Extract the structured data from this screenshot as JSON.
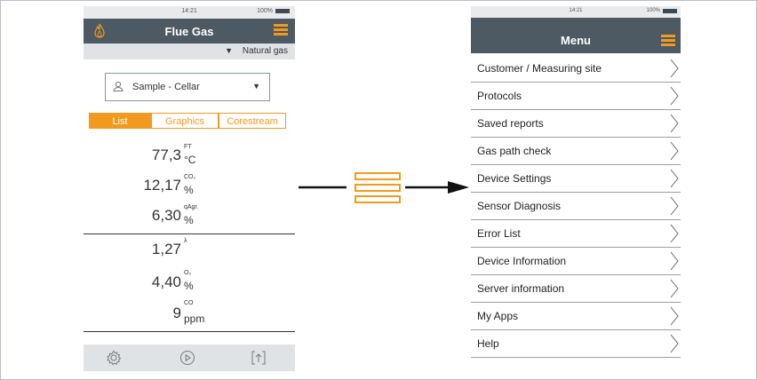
{
  "left_screen": {
    "status_time": "14:21",
    "status_battery": "100%",
    "title": "Flue Gas",
    "gas_type": "Natural gas",
    "sample": "Sample - Cellar",
    "tabs": [
      "List",
      "Graphics",
      "Corestream"
    ],
    "active_tab": "List",
    "readings": [
      {
        "value": "77,3",
        "label": "FT",
        "unit": "°C"
      },
      {
        "value": "12,17",
        "label": "CO₂",
        "unit": "%"
      },
      {
        "value": "6,30",
        "label": "qAgr.",
        "unit": "%"
      },
      {
        "value": "1,27",
        "label": "λ",
        "unit": ""
      },
      {
        "value": "4,40",
        "label": "O₂",
        "unit": "%"
      },
      {
        "value": "9",
        "label": "CO",
        "unit": "ppm"
      }
    ],
    "bottom_icons": [
      "gear-icon",
      "play-icon",
      "upload-icon"
    ]
  },
  "right_screen": {
    "status_time": "14:21",
    "status_battery": "100%",
    "title": "Menu",
    "items": [
      "Customer / Measuring site",
      "Protocols",
      "Saved reports",
      "Gas path check",
      "Device Settings",
      "Sensor Diagnosis",
      "Error List",
      "Device Information",
      "Server information",
      "My Apps",
      "Help"
    ]
  },
  "colors": {
    "accent": "#f29a1f",
    "header": "#4d5963",
    "bar": "#dfe3e6"
  }
}
